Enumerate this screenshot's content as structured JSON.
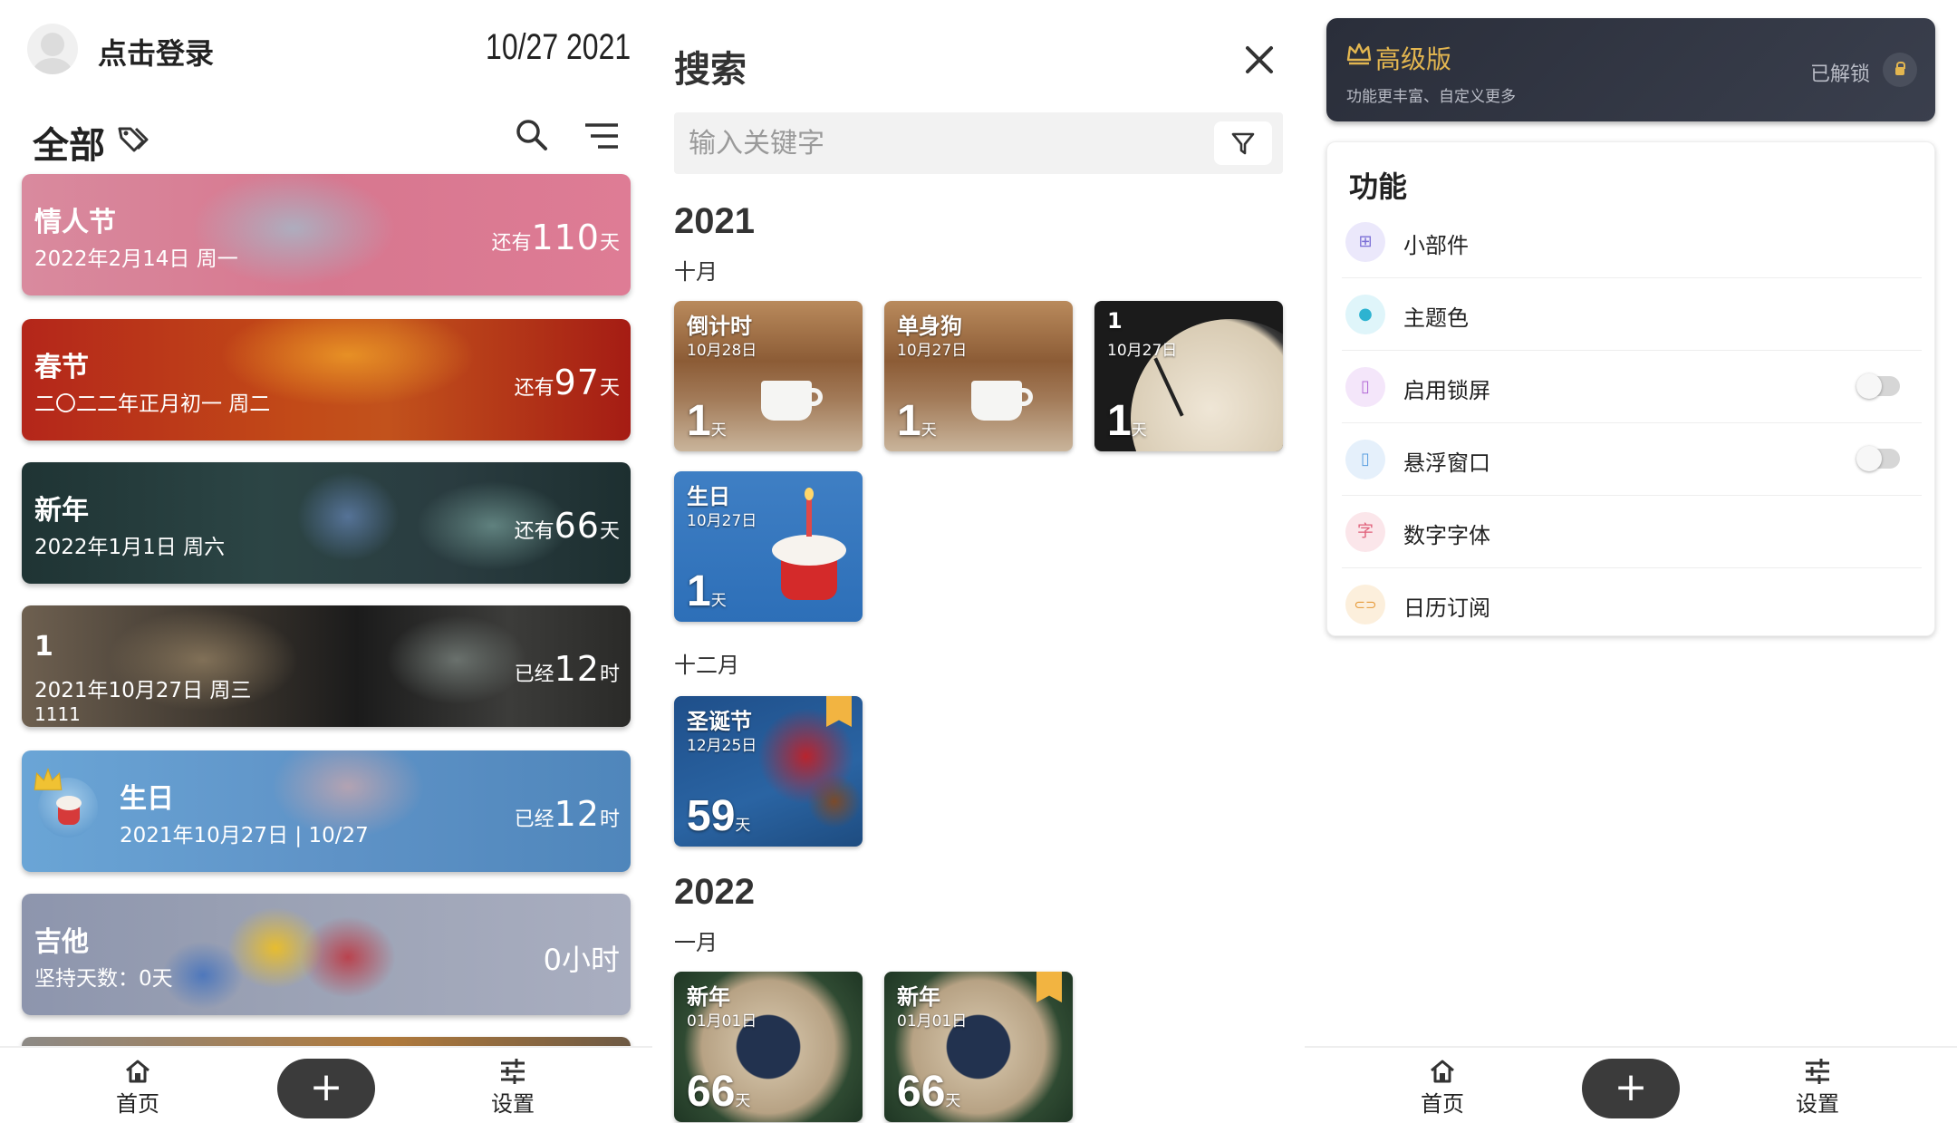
{
  "panel_home": {
    "login_label": "点击登录",
    "date": "10/27 2021",
    "filter_label": "全部",
    "cards": [
      {
        "title": "情人节",
        "subtitle": "2022年2月14日 周一",
        "prefix": "还有",
        "number": "110",
        "unit": "天"
      },
      {
        "title": "春节",
        "subtitle": "二〇二二年正月初一 周二",
        "prefix": "还有",
        "number": "97",
        "unit": "天"
      },
      {
        "title": "新年",
        "subtitle": "2022年1月1日 周六",
        "prefix": "还有",
        "number": "66",
        "unit": "天"
      },
      {
        "title": "1",
        "subtitle": "2021年10月27日 周三",
        "note": "1111",
        "prefix": "已经",
        "number": "12",
        "unit": "时"
      },
      {
        "title": "生日",
        "subtitle": "2021年10月27日 | 10/27",
        "prefix": "已经",
        "number": "12",
        "unit": "时"
      },
      {
        "title": "吉他",
        "subtitle": "坚持天数：0天",
        "value": "0小时"
      }
    ],
    "nav": {
      "home": "首页",
      "add": "+",
      "settings": "设置"
    }
  },
  "panel_search": {
    "title": "搜索",
    "placeholder": "输入关键字",
    "groups": [
      {
        "year": "2021",
        "month": "十月",
        "tiles": [
          {
            "title": "倒计时",
            "date": "10月28日",
            "number": "1",
            "unit": "天"
          },
          {
            "title": "单身狗",
            "date": "10月27日",
            "number": "1",
            "unit": "天"
          },
          {
            "title": "1",
            "date": "10月27日",
            "number": "1",
            "unit": "天"
          },
          {
            "title": "生日",
            "date": "10月27日",
            "number": "1",
            "unit": "天"
          }
        ]
      },
      {
        "month": "十二月",
        "tiles": [
          {
            "title": "圣诞节",
            "date": "12月25日",
            "number": "59",
            "unit": "天"
          }
        ]
      },
      {
        "year": "2022",
        "month": "一月",
        "tiles": [
          {
            "title": "新年",
            "date": "01月01日",
            "number": "66",
            "unit": "天"
          },
          {
            "title": "新年",
            "date": "01月01日",
            "number": "66",
            "unit": "天"
          }
        ]
      }
    ]
  },
  "panel_settings": {
    "premium": {
      "title": "高级版",
      "subtitle": "功能更丰富、自定义更多",
      "status": "已解锁"
    },
    "section_title": "功能",
    "items": [
      {
        "label": "小部件",
        "icon": "widgets-icon",
        "color": "#7b6fd6",
        "bg": "#ebe8fb",
        "glyph": "⊞"
      },
      {
        "label": "主题色",
        "icon": "palette-icon",
        "color": "#2db3d1",
        "bg": "#dff5fa",
        "glyph": "●"
      },
      {
        "label": "启用锁屏",
        "icon": "lockscreen-icon",
        "color": "#b36ad6",
        "bg": "#f4e6fa",
        "glyph": "▯"
      },
      {
        "label": "悬浮窗口",
        "icon": "floating-window-icon",
        "color": "#5a9fe0",
        "bg": "#e5f0fb",
        "glyph": "▯"
      },
      {
        "label": "数字字体",
        "icon": "font-icon",
        "color": "#e0607a",
        "bg": "#fbe6ea",
        "glyph": "字"
      },
      {
        "label": "日历订阅",
        "icon": "link-icon",
        "color": "#e69a3a",
        "bg": "#fcefdc",
        "glyph": "⊂⊃"
      }
    ],
    "nav": {
      "home": "首页",
      "add": "+",
      "settings": "设置"
    }
  }
}
